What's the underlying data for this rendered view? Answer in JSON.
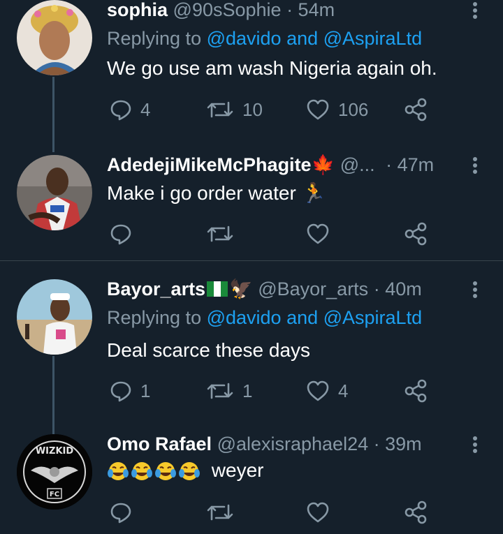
{
  "tweets": [
    {
      "name": "sophia",
      "handle": "@90sSophie",
      "time": "· 54m",
      "replying_prefix": "Replying to ",
      "replying_mentions": "@davido and @AspiraLtd",
      "text": "We go use am wash Nigeria again oh.",
      "replies": "4",
      "retweets": "10",
      "likes": "106"
    },
    {
      "name": "AdedejiMikeMcPhagite",
      "name_emoji": "🍁",
      "handle": "@...",
      "time": "· 47m",
      "text": "Make i go order water",
      "text_emoji": "🏃",
      "replies": "",
      "retweets": "",
      "likes": ""
    },
    {
      "name": "Bayor_arts",
      "name_emoji": "🦅",
      "handle": "@Bayor_arts",
      "time": "· 40m",
      "replying_prefix": "Replying to ",
      "replying_mentions": "@davido and @AspiraLtd",
      "text": "Deal scarce these days",
      "replies": "1",
      "retweets": "1",
      "likes": "4"
    },
    {
      "name": "Omo Rafael",
      "handle": "@alexisraphael24",
      "time": "· 39m",
      "text": "weyer",
      "replies": "",
      "retweets": "",
      "likes": "",
      "avatar_text": "WIZKID",
      "avatar_sub": "FC"
    }
  ],
  "icons": {
    "reply": "reply-icon",
    "retweet": "retweet-icon",
    "like": "heart-icon",
    "share": "share-icon",
    "more": "more-vertical-icon"
  },
  "colors": {
    "background": "#15202b",
    "muted": "#8899a6",
    "link": "#1da1f2",
    "divider": "#38444d"
  }
}
